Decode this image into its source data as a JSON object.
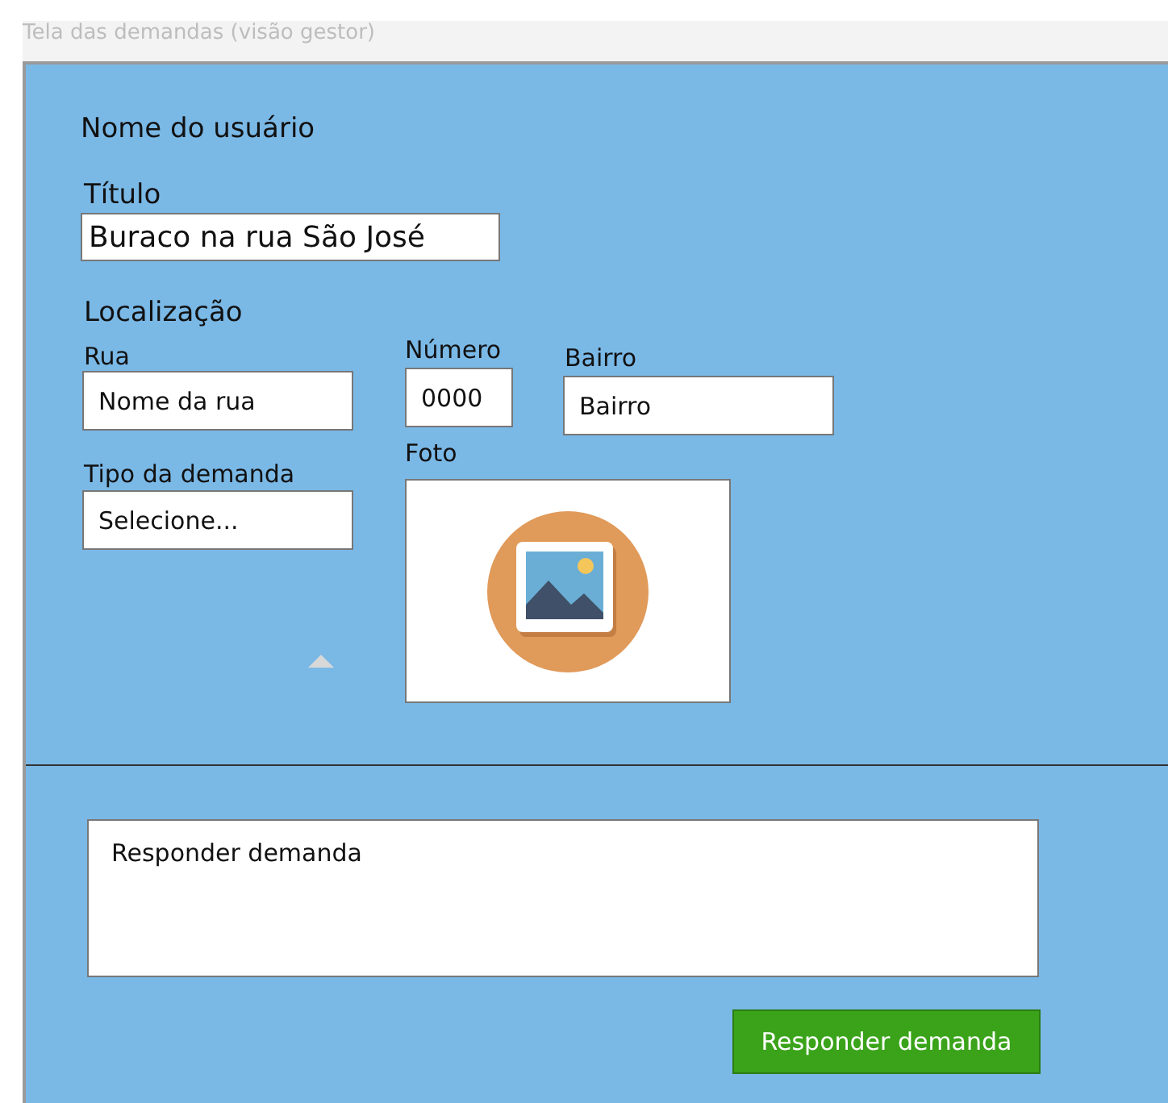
{
  "window": {
    "title": "Tela das demandas (visão gestor)"
  },
  "form": {
    "user_name": "Nome do usuário",
    "title_label": "Título",
    "title_value": "Buraco na rua São José",
    "location_label": "Localização",
    "fields": [
      {
        "label": "Rua",
        "value": "Nome da rua"
      },
      {
        "label": "Número",
        "value": "0000"
      },
      {
        "label": "Bairro",
        "value": "Bairro"
      },
      {
        "label": "Tipo da demanda",
        "value": "Selecione..."
      }
    ],
    "photo_label": "Foto"
  },
  "reply": {
    "value": "Responder demanda",
    "button": "Responder demanda"
  }
}
